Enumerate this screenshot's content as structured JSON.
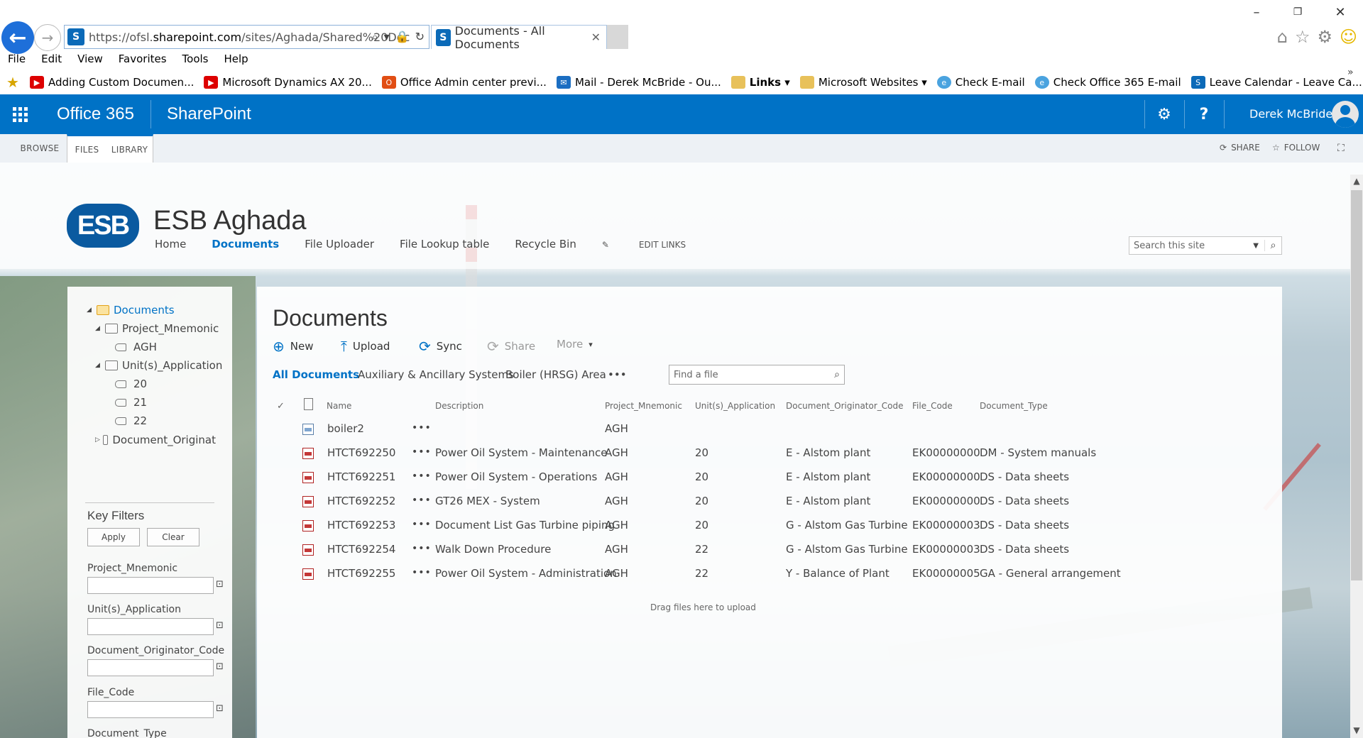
{
  "browser": {
    "url_prefix": "https://ofsl.",
    "url_domain": "sharepoint.com",
    "url_path": "/sites/Aghada/Shared%20Doc",
    "tab_title": "Documents - All Documents",
    "menu": [
      "File",
      "Edit",
      "View",
      "Favorites",
      "Tools",
      "Help"
    ],
    "favorites": [
      {
        "label": "Adding Custom Documen...",
        "icon": "youtube-icon"
      },
      {
        "label": "Microsoft Dynamics AX 20...",
        "icon": "youtube-icon"
      },
      {
        "label": "Office Admin center previ...",
        "icon": "office-icon"
      },
      {
        "label": "Mail - Derek McBride - Ou...",
        "icon": "mail-icon"
      },
      {
        "label": "Links ▾",
        "icon": "folder-icon"
      },
      {
        "label": "Microsoft Websites ▾",
        "icon": "folder-icon"
      },
      {
        "label": "Check E-mail",
        "icon": "ie-icon"
      },
      {
        "label": "Check Office 365 E-mail",
        "icon": "ie-icon"
      },
      {
        "label": "Leave Calendar - Leave Ca...",
        "icon": "sharepoint-icon"
      }
    ]
  },
  "suite": {
    "app_name": "Office 365",
    "product": "SharePoint",
    "user": "Derek McBride"
  },
  "ribbon": {
    "tabs": [
      "BROWSE",
      "FILES",
      "LIBRARY"
    ],
    "share": "SHARE",
    "follow": "FOLLOW"
  },
  "site": {
    "logo_text": "ESB",
    "title": "ESB Aghada",
    "nav": [
      "Home",
      "Documents",
      "File Uploader",
      "File Lookup table",
      "Recycle Bin"
    ],
    "edit_links": "EDIT LINKS",
    "search_placeholder": "Search this site"
  },
  "tree": {
    "root": "Documents",
    "project": "Project_Mnemonic",
    "agh": "AGH",
    "units": "Unit(s)_Application",
    "u20": "20",
    "u21": "21",
    "u22": "22",
    "originator": "Document_Originat"
  },
  "key_filters": {
    "title": "Key Filters",
    "apply": "Apply",
    "clear": "Clear",
    "fields": [
      "Project_Mnemonic",
      "Unit(s)_Application",
      "Document_Originator_Code",
      "File_Code",
      "Document_Type"
    ]
  },
  "library": {
    "title": "Documents",
    "commands": {
      "new": "New",
      "upload": "Upload",
      "sync": "Sync",
      "share": "Share",
      "more": "More"
    },
    "views": [
      "All Documents",
      "Auxiliary & Ancillary Systems",
      "Boiler (HRSG) Area",
      "•••"
    ],
    "find_placeholder": "Find a file",
    "columns": [
      "Name",
      "Description",
      "Project_Mnemonic",
      "Unit(s)_Application",
      "Document_Originator_Code",
      "File_Code",
      "Document_Type"
    ],
    "rows": [
      {
        "name": "boiler2",
        "desc": "",
        "proj": "AGH",
        "unit": "",
        "orig": "",
        "file": "",
        "type": "",
        "icon": "image"
      },
      {
        "name": "HTCT692250",
        "desc": "Power Oil System - Maintenance",
        "proj": "AGH",
        "unit": "20",
        "orig": "E - Alstom plant",
        "file": "EK00000000",
        "type": "DM - System manuals",
        "icon": "pdf"
      },
      {
        "name": "HTCT692251",
        "desc": "Power Oil System - Operations",
        "proj": "AGH",
        "unit": "20",
        "orig": "E - Alstom plant",
        "file": "EK00000000",
        "type": "DS - Data sheets",
        "icon": "pdf"
      },
      {
        "name": "HTCT692252",
        "desc": "GT26 MEX - System",
        "proj": "AGH",
        "unit": "20",
        "orig": "E - Alstom plant",
        "file": "EK00000000",
        "type": "DS - Data sheets",
        "icon": "pdf"
      },
      {
        "name": "HTCT692253",
        "desc": "Document List Gas Turbine piping",
        "proj": "AGH",
        "unit": "20",
        "orig": "G - Alstom Gas Turbine",
        "file": "EK00000003",
        "type": "DS - Data sheets",
        "icon": "pdf"
      },
      {
        "name": "HTCT692254",
        "desc": "Walk Down Procedure",
        "proj": "AGH",
        "unit": "22",
        "orig": "G - Alstom Gas Turbine",
        "file": "EK00000003",
        "type": "DS - Data sheets",
        "icon": "pdf"
      },
      {
        "name": "HTCT692255",
        "desc": "Power Oil System - Administration",
        "proj": "AGH",
        "unit": "22",
        "orig": "Y - Balance of Plant",
        "file": "EK00000005",
        "type": "GA - General arrangement",
        "icon": "pdf"
      }
    ],
    "drag_hint": "Drag files here to upload"
  }
}
